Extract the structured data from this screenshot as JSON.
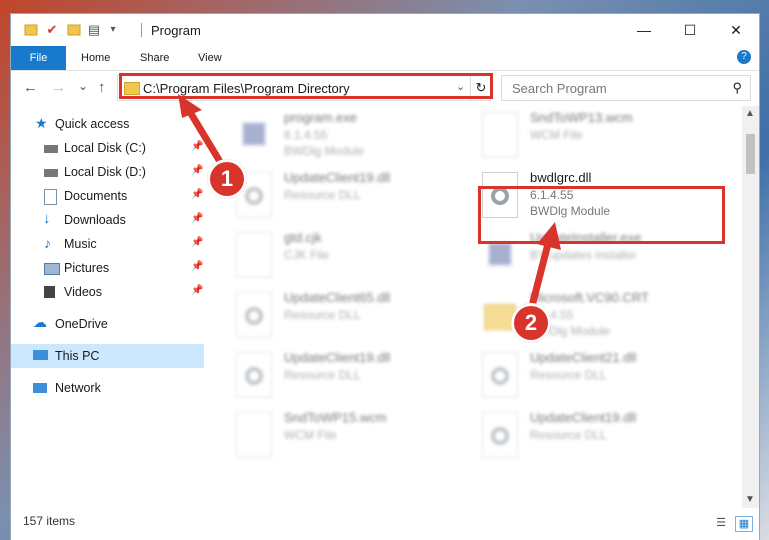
{
  "window": {
    "title": "Program",
    "minimize_glyph": "—",
    "maximize_glyph": "☐",
    "close_glyph": "✕"
  },
  "ribbon": {
    "tabs": [
      {
        "label": "File"
      },
      {
        "label": "Home"
      },
      {
        "label": "Share"
      },
      {
        "label": "View"
      }
    ],
    "help_glyph": "?"
  },
  "nav": {
    "back_glyph": "←",
    "forward_glyph": "→",
    "recent_glyph": "⌄",
    "up_glyph": "↑",
    "address": "C:\\Program Files\\Program Directory",
    "address_dropdown_glyph": "⌄",
    "refresh_glyph": "↻",
    "search_placeholder": "Search Program",
    "search_glyph": "⚲"
  },
  "sidebar": {
    "quick_access": "Quick access",
    "items": [
      {
        "label": "Local Disk (C:)",
        "icon": "drive-icon",
        "pinned": true
      },
      {
        "label": "Local Disk (D:)",
        "icon": "drive-icon",
        "pinned": true
      },
      {
        "label": "Documents",
        "icon": "documents-icon",
        "pinned": true
      },
      {
        "label": "Downloads",
        "icon": "downloads-icon",
        "pinned": true
      },
      {
        "label": "Music",
        "icon": "music-icon",
        "pinned": true
      },
      {
        "label": "Pictures",
        "icon": "pictures-icon",
        "pinned": true
      },
      {
        "label": "Videos",
        "icon": "videos-icon",
        "pinned": true
      }
    ],
    "onedrive": "OneDrive",
    "this_pc": "This PC",
    "network": "Network",
    "pin_glyph": "📌"
  },
  "files": [
    {
      "name": "program.exe",
      "line2": "6.1.4.55",
      "line3": "BWDlg Module",
      "icon": "exe-icon"
    },
    {
      "name": "SndToWP13.wcm",
      "line2": "WCM File",
      "line3": "",
      "icon": "file-icon"
    },
    {
      "name": "UpdateClient19.dll",
      "line2": "Resource DLL",
      "line3": "",
      "icon": "dll-icon"
    },
    {
      "name": "bwdlgrc.dll",
      "line2": "6.1.4.55",
      "line3": "BWDlg Module",
      "icon": "dll-icon"
    },
    {
      "name": "gtd.cjk",
      "line2": "CJK File",
      "line3": "",
      "icon": "file-icon"
    },
    {
      "name": "UpdateInstaller.exe",
      "line2": "BY updates installer",
      "line3": "",
      "icon": "exe-icon"
    },
    {
      "name": "UpdateClient65.dll",
      "line2": "Resource DLL",
      "line3": "",
      "icon": "dll-icon"
    },
    {
      "name": "Microsoft.VC90.CRT",
      "line2": "6.1.4.55",
      "line3": "BWDlg Module",
      "icon": "folder-icon"
    },
    {
      "name": "UpdateClient19.dll",
      "line2": "Resource DLL",
      "line3": "",
      "icon": "dll-icon"
    },
    {
      "name": "UpdateClient21.dll",
      "line2": "Resource DLL",
      "line3": "",
      "icon": "dll-icon"
    },
    {
      "name": "SndToWP15.wcm",
      "line2": "WCM File",
      "line3": "",
      "icon": "file-icon"
    },
    {
      "name": "UpdateClient19.dll",
      "line2": "Resource DLL",
      "line3": "",
      "icon": "dll-icon"
    }
  ],
  "status": {
    "item_count": "157 items"
  },
  "callouts": [
    "1",
    "2"
  ],
  "colors": {
    "accent": "#1979ca",
    "highlight": "#d9342b",
    "selection": "#cce8ff"
  }
}
